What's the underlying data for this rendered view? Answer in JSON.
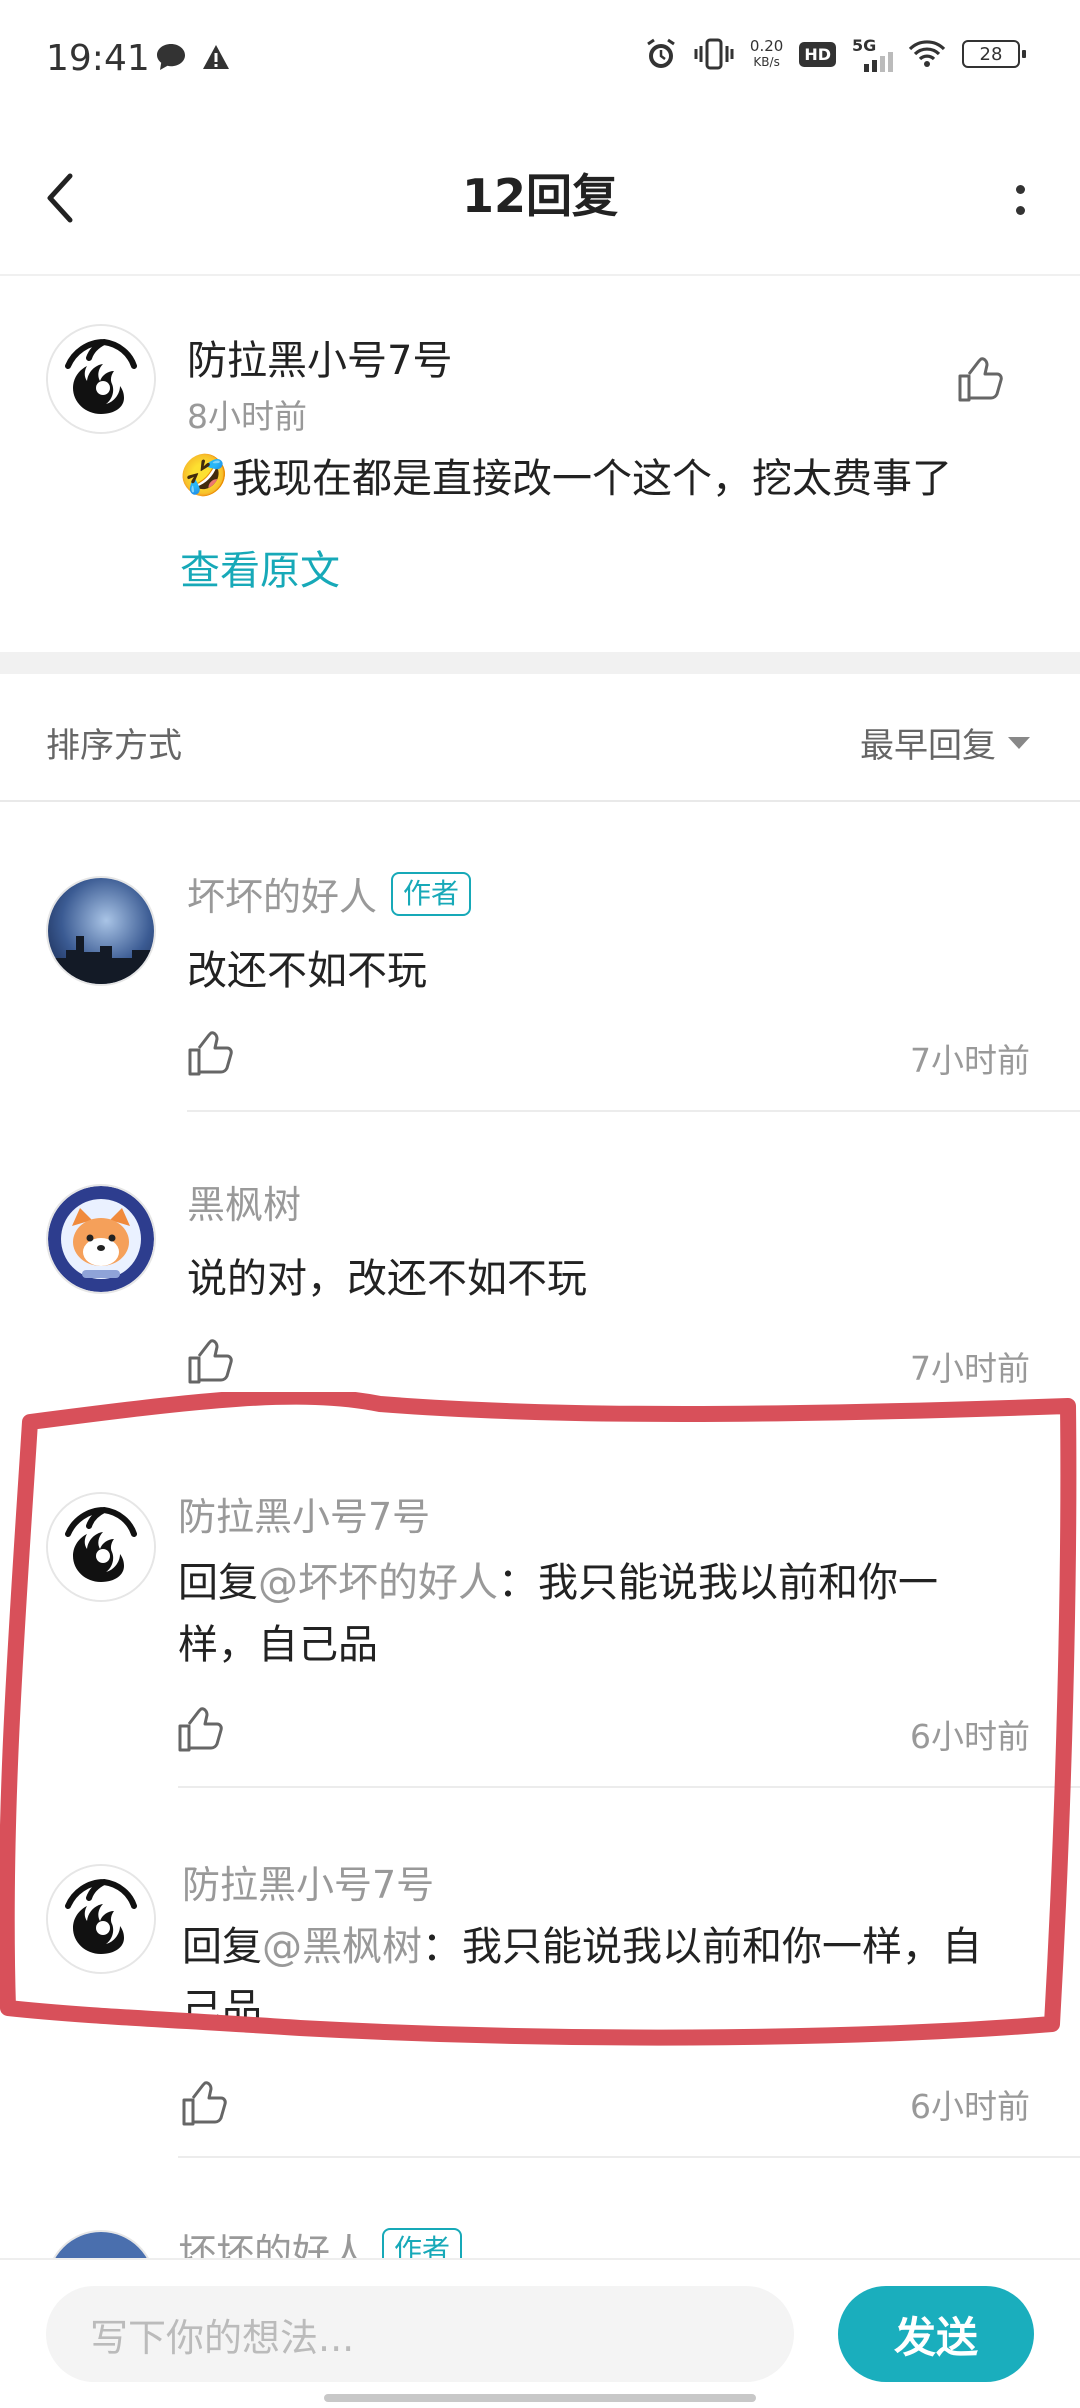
{
  "status_bar": {
    "time": "19:41",
    "speed_value": "0.20",
    "speed_unit": "KB/s",
    "hd": "HD",
    "network": "5G",
    "battery": "28"
  },
  "header": {
    "title": "12回复"
  },
  "main_comment": {
    "author": "防拉黑小号7号",
    "time": "8小时前",
    "emoji": "🤣",
    "text": "我现在都是直接改一个这个，挖太费事了",
    "view_original": "查看原文"
  },
  "sort": {
    "label": "排序方式",
    "value": "最早回复"
  },
  "author_badge": "作者",
  "replies": [
    {
      "author": "坏坏的好人",
      "is_author": true,
      "text": "改还不如不玩",
      "time": "7小时前"
    },
    {
      "author": "黑枫树",
      "is_author": false,
      "text": "说的对，改还不如不玩",
      "time": "7小时前"
    },
    {
      "author": "防拉黑小号7号",
      "is_author": false,
      "reply_prefix": "回复",
      "reply_to": "@坏坏的好人",
      "text_line1": "：我只能说我以前和你一",
      "text_line2": "样，自己品",
      "time": "6小时前"
    },
    {
      "author": "防拉黑小号7号",
      "is_author": false,
      "reply_prefix": "回复",
      "reply_to": "@黑枫树",
      "text_line1": "：我只能说我以前和你一样，自",
      "text_line2": "己品",
      "time": "6小时前"
    },
    {
      "author": "坏坏的好人",
      "is_author": true
    }
  ],
  "input": {
    "placeholder": "写下你的想法...",
    "send_label": "发送"
  },
  "colors": {
    "accent": "#17a9b8",
    "annotation": "#d8505a"
  }
}
